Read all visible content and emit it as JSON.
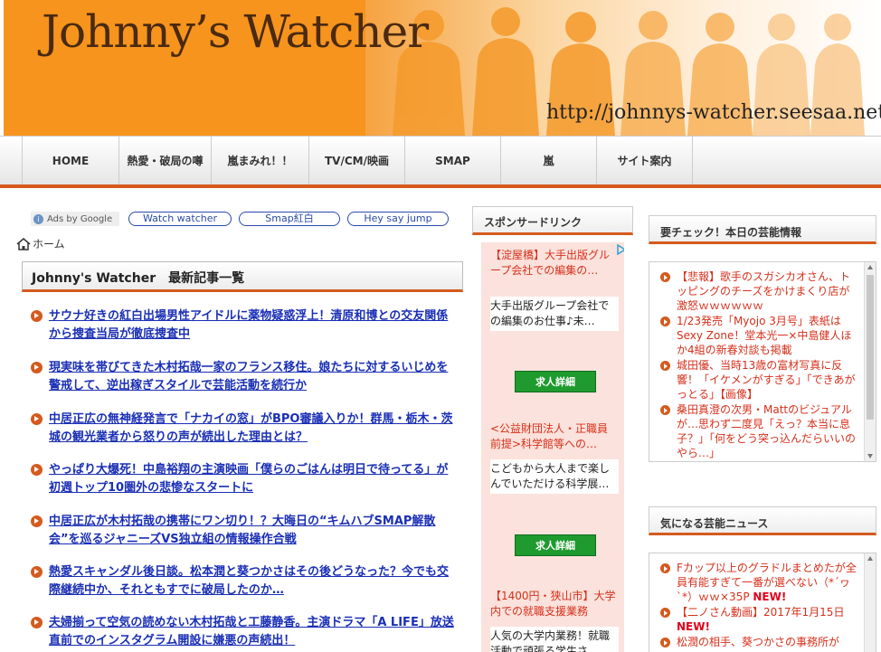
{
  "header": {
    "site_title": "Johnny’s Watcher",
    "site_url": "http://johnnys-watcher.seesaa.net/"
  },
  "nav": {
    "items": [
      "HOME",
      "熱愛・破局の噂",
      "嵐まみれ！！",
      "TV/CM/映画",
      "SMAP",
      "嵐",
      "サイト案内"
    ]
  },
  "ads_row": {
    "ads_by_google": "Ads by Google",
    "links": [
      "Watch watcher",
      "Smap紅白",
      "Hey say jump"
    ]
  },
  "breadcrumb": {
    "home": "ホーム"
  },
  "main": {
    "heading": "Johnny's Watcher　最新記事一覧",
    "articles": [
      "サウナ好きの紅白出場男性アイドルに薬物疑惑浮上！清原和博との交友関係から捜査当局が徹底捜査中",
      "現実味を帯びてきた木村拓哉一家のフランス移住。娘たちに対するいじめを警戒して、逆出稼ぎスタイルで芸能活動を続行か",
      "中居正広の無神経発言で「ナカイの窓」がBPO審議入りか！群馬・栃木・茨城の観光業者から怒りの声が続出した理由とは？",
      "やっぱり大爆死！中島裕翔の主演映画「僕らのごはんは明日で待ってる」が初週トップ10圏外の悲惨なスタートに",
      "中居正広が木村拓哉の携帯にワン切り！？大晦日の“キムハブSMAP解散会”を巡るジャニーズVS独立組の情報操作合戦",
      "熱愛スキャンダル後日談。松本潤と葵つかさはその後どうなった？今でも交際継続中か、それともすでに破局したのか…",
      "夫婦揃って空気の読めない木村拓哉と工藤静香。主演ドラマ「A LIFE」放送直前でのインスタグラム開設に嫌悪の声続出！"
    ]
  },
  "sponsor": {
    "heading": "スポンサードリンク",
    "ads": [
      {
        "title": "【淀屋橋】大手出版グループ会社での編集の…",
        "body": "大手出版グループ会社での編集のお仕事♪未…",
        "button": "求人詳細"
      },
      {
        "title": "<公益財団法人・正職員前提>科学館等への…",
        "body": "こどもから大人まで楽しんでいただける科学展…",
        "button": "求人詳細"
      },
      {
        "title": "【1400円・狭山市】大学内での就職支援業務",
        "body": "人気の大学内業務！就職活動で頑張る学生さ…",
        "button": ""
      }
    ]
  },
  "right": {
    "box1_heading": "要チェック！本日の芸能情報",
    "box1_items": [
      {
        "text": "【悲報】歌手のスガシカオさん、トッピングのチーズをかけまくり店が激怒ｗｗｗｗｗｗ",
        "new": ""
      },
      {
        "text": "1/23発売「Myojo 3月号」表紙はSexy Zone！堂本光一×中島健人ほか4組の新春対談も掲載",
        "new": ""
      },
      {
        "text": "城田優、当時13歳の富材写真に反響！「イケメンがすぎる」「できあがっとる」【画像】",
        "new": ""
      },
      {
        "text": "桑田真澄の次男・Mattのビジュアルが…思わず二度見「えっ？本当に息子？」「何をどう突っ込んだらいいのやら…」",
        "new": ""
      },
      {
        "text": "",
        "new": ""
      }
    ],
    "box2_heading": "気になる芸能ニュース",
    "box2_items": [
      {
        "text": "Fカップ以上のグラドルまとめたが全員有能すぎて一番が選べない（*´ヮ`*）ｗｗ×35P",
        "new": "NEW!"
      },
      {
        "text": "【二ノさん動画】2017年1月15日",
        "new": "NEW!"
      },
      {
        "text": "松潤の相手、葵つかさの事務所が",
        "new": ""
      }
    ]
  },
  "colors": {
    "accent": "#d45a1e",
    "header_orange": "#f7941d",
    "link": "#1a2fb5",
    "red_text": "#d6301c",
    "button_green": "#1e9a2e"
  }
}
